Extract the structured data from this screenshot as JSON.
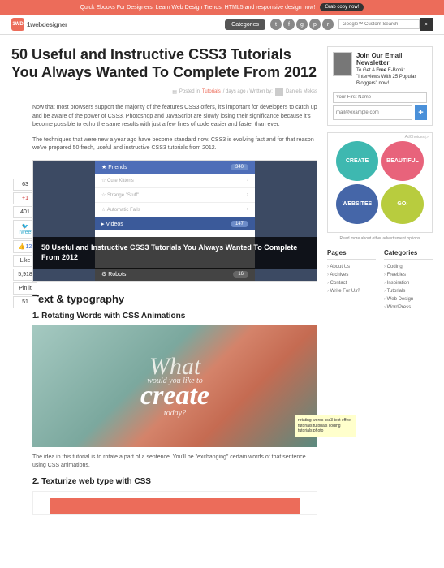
{
  "topbar": {
    "text": "Quick Ebooks For Designers: Learn Web Design Trends, HTML5 and responsive design now!",
    "cta": "Grab copy now!"
  },
  "header": {
    "logo_badge": "1WD",
    "logo_text": "1webdesigner",
    "categories_btn": "Categories",
    "social": [
      "t",
      "f",
      "g",
      "p",
      "r"
    ],
    "search_placeholder": "Google™ Custom Search"
  },
  "article": {
    "title": "50 Useful and Instructive CSS3 Tutorials You Always Wanted To Complete From 2012",
    "meta_prefix": "Posted in",
    "meta_category": "Tutorials",
    "meta_mid": "/ days ago / Written by:",
    "meta_author": "Daniels Mekss",
    "para1": "Now that most browsers support the majority of the features CSS3 offers, it's important for developers to catch up and be aware of the power of CSS3. Photoshop and JavaScript are slowly losing their significance because it's become possible to echo the same results with just a few lines of code easier and faster than ever.",
    "para2": "The techniques that were new a year ago have become standard now. CSS3 is evolving fast and for that reason we've prepared 50 fresh, useful and instructive CSS3 tutorials from 2012.",
    "feature": {
      "friends_label": "Friends",
      "friends_count": "340",
      "rows": [
        "Cute Kittens",
        "Strange \"Stuff\"",
        "Automatic Fails"
      ],
      "videos_label": "Videos",
      "videos_count": "147",
      "robots_label": "Robots",
      "robots_count": "16",
      "overlay": "50 Useful and Instructive CSS3 Tutorials You Always Wanted To Complete From 2012"
    },
    "h2_text": "Text & typography",
    "tut1_title": "1. Rotating Words with CSS Animations",
    "tut1_img": {
      "what": "What",
      "would": "would you like to",
      "create": "create",
      "today": "today?"
    },
    "tut1_tooltip": "rotating words css3 text effect tutorials tutorials coding tutorials photo",
    "tut1_desc": "The idea in this tutorial is to rotate a part of a sentence. You'll be \"exchanging\" certain words of that sentence using CSS animations.",
    "tut2_title": "2. Texturize web type with CSS"
  },
  "share": {
    "count1": "63",
    "gplus": "+1",
    "count2": "401",
    "tweet": "Tweet",
    "fblike": "12",
    "like_label": "Like",
    "su": "5,918",
    "pin": "Pin it",
    "sh": "51"
  },
  "sidebar": {
    "newsletter": {
      "title": "Join Our Email Newsletter",
      "sub_pre": "To Get A ",
      "sub_bold": "Free",
      "sub_post": " E-Book: \"Interviews With 25 Popular Bloggers\" now!",
      "name_ph": "Your First Name",
      "email_ph": "mail@example.com",
      "btn": "+"
    },
    "ad": {
      "label": "AdChoices ▷",
      "c1": "CREATE",
      "c2": "BEAUTIFUL",
      "c3": "WEBSITES",
      "c4": "GO›",
      "note": "Read more about other advertisment options"
    },
    "pages_h": "Pages",
    "pages": [
      "About Us",
      "Archives",
      "Contact",
      "Write For Us?"
    ],
    "cats_h": "Categories",
    "cats": [
      "Coding",
      "Freebies",
      "Inspiration",
      "Tutorials",
      "Web Design",
      "WordPress"
    ]
  }
}
